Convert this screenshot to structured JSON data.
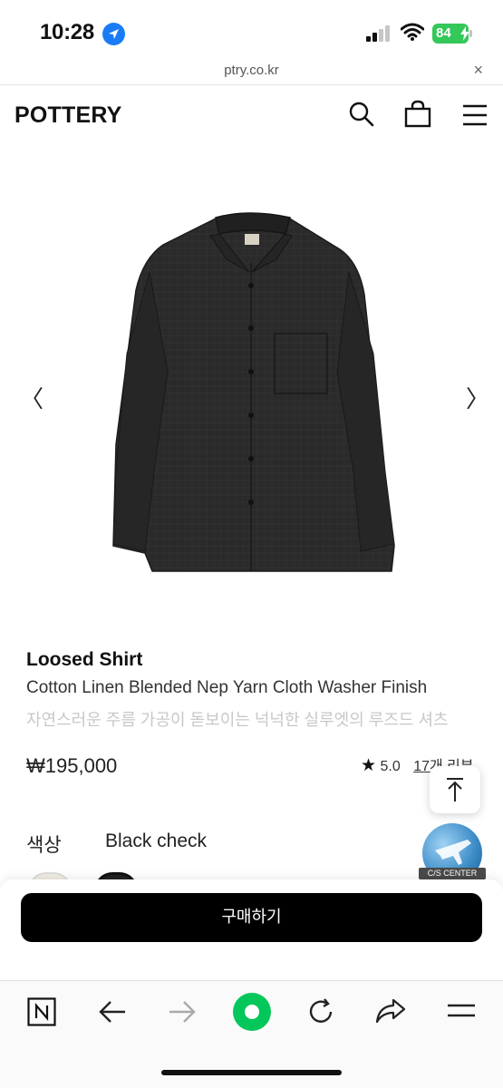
{
  "status_bar": {
    "time": "10:28",
    "battery": "84",
    "colors": {
      "battery": "#34c759",
      "location": "#1a7cf5"
    }
  },
  "url_bar": {
    "url": "ptry.co.kr",
    "close_glyph": "×"
  },
  "header": {
    "logo": "POTTERY",
    "icons": [
      "search-icon",
      "shopping-bag-icon",
      "menu-icon"
    ]
  },
  "gallery": {
    "prev_glyph": "〈",
    "next_glyph": "〉"
  },
  "product": {
    "name": "Loosed Shirt",
    "subtitle": "Cotton Linen Blended Nep Yarn Cloth Washer Finish",
    "description": "자연스러운 주름 가공이 돋보이는 넉넉한 실루엣의 루즈드 셔츠",
    "price": "₩195,000",
    "rating": "5.0",
    "reviews": "17개 리뷰",
    "color_label": "색상",
    "color_value": "Black check"
  },
  "cs_center": {
    "label": "C/S CENTER"
  },
  "buy": {
    "label": "구매하기"
  },
  "toolbar": {
    "icons": [
      "naver-icon",
      "back-arrow-icon",
      "forward-arrow-icon",
      "green-home-icon",
      "refresh-icon",
      "share-icon",
      "menu-icon"
    ],
    "accent": "#03c75a"
  }
}
